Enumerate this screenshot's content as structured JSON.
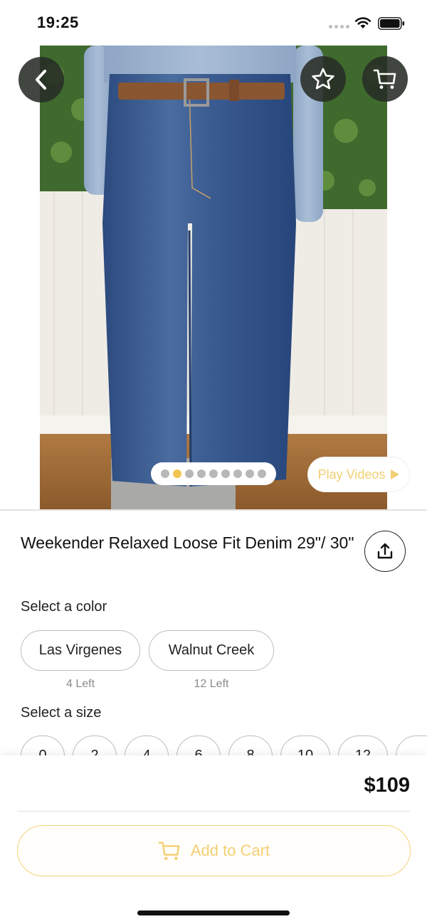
{
  "status_bar": {
    "time": "19:25"
  },
  "icons": {
    "back": "chevron-left-icon",
    "favorite": "star-outline-icon",
    "cart": "cart-icon",
    "share": "share-upload-icon",
    "play": "play-triangle-icon"
  },
  "gallery": {
    "page_count": 9,
    "active_index": 1,
    "play_videos_label": "Play Videos"
  },
  "product": {
    "title": "Weekender Relaxed Loose Fit Denim 29\"/ 30\"",
    "price": "$109"
  },
  "color_section": {
    "label": "Select a color",
    "options": [
      {
        "name": "Las Virgenes",
        "stock": "4 Left"
      },
      {
        "name": "Walnut Creek",
        "stock": "12 Left"
      }
    ]
  },
  "size_section": {
    "label": "Select a size",
    "sizes": [
      "0",
      "2",
      "4",
      "6",
      "8",
      "10",
      "12",
      ""
    ]
  },
  "actions": {
    "add_to_cart_label": "Add to Cart"
  },
  "colors": {
    "accent": "#f3cf73",
    "button_dark": "#282c26",
    "chip_border": "#bdbdbd"
  }
}
